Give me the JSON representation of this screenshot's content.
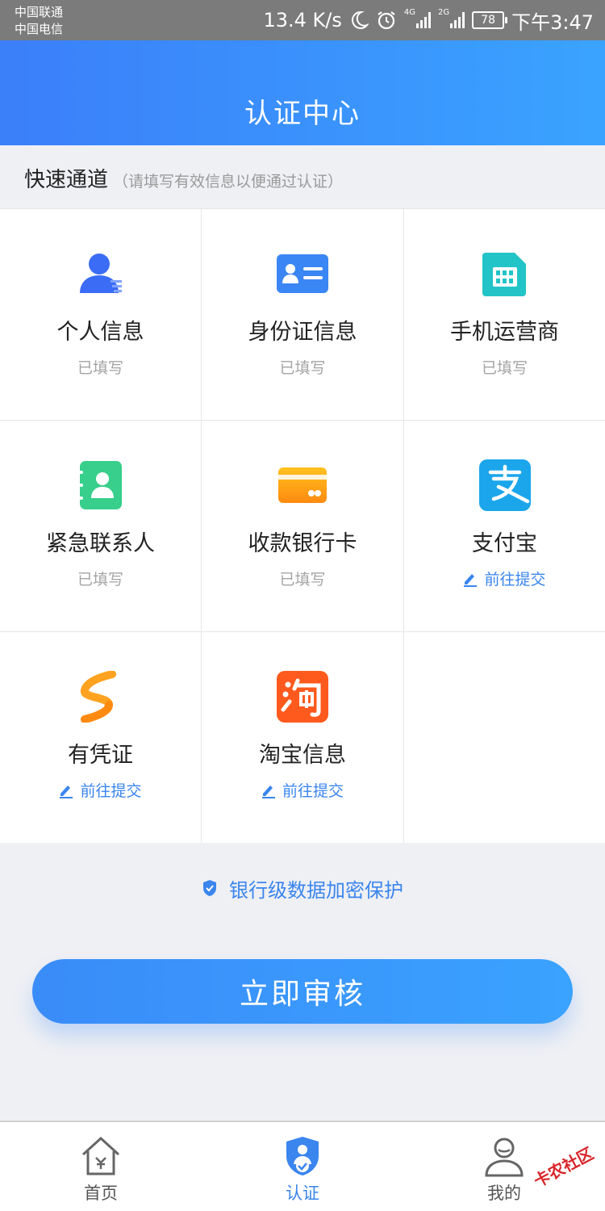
{
  "status_bar": {
    "carrier_1": "中国联通",
    "carrier_2": "中国电信",
    "speed": "13.4 K/s",
    "network_1": "4G",
    "network_2": "2G",
    "battery": "78",
    "time": "下午3:47"
  },
  "header": {
    "title": "认证中心"
  },
  "section": {
    "title": "快速通道",
    "hint": "（请填写有效信息以便通过认证）"
  },
  "items": [
    {
      "title": "个人信息",
      "status": "已填写",
      "icon": "person-icon",
      "color": "#3b6cf6"
    },
    {
      "title": "身份证信息",
      "status": "已填写",
      "icon": "id-card-icon",
      "color": "#3a86f5"
    },
    {
      "title": "手机运营商",
      "status": "已填写",
      "icon": "sim-card-icon",
      "color": "#22c4c8"
    },
    {
      "title": "紧急联系人",
      "status": "已填写",
      "icon": "contacts-icon",
      "color": "#37cf8b"
    },
    {
      "title": "收款银行卡",
      "status": "已填写",
      "icon": "bank-card-icon",
      "color": "#ffa51a"
    },
    {
      "title": "支付宝",
      "status": "前往提交",
      "icon": "alipay-icon",
      "color": "#1ba6ec"
    },
    {
      "title": "有凭证",
      "status": "前往提交",
      "icon": "voucher-icon",
      "color": "#ffa21f"
    },
    {
      "title": "淘宝信息",
      "status": "前往提交",
      "icon": "taobao-icon",
      "color": "#ff5a1d"
    }
  ],
  "security_note": "银行级数据加密保护",
  "submit_label": "立即审核",
  "tabs": [
    {
      "label": "首页",
      "icon": "home-icon",
      "active": false
    },
    {
      "label": "认证",
      "icon": "shield-check-icon",
      "active": true
    },
    {
      "label": "我的",
      "icon": "user-icon",
      "active": false
    }
  ],
  "watermark": "卡农社区",
  "colors": {
    "accent": "#3a85ee",
    "header_start": "#3b7ff9",
    "header_end": "#3aa3ff"
  }
}
